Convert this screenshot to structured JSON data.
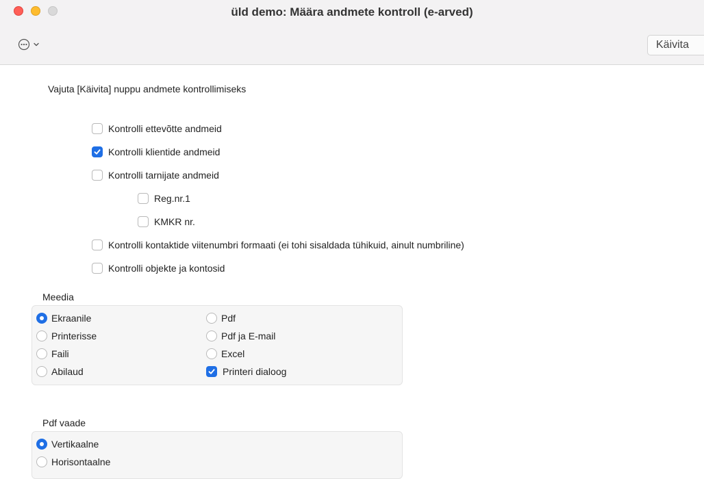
{
  "window": {
    "title": "üld demo: Määra andmete kontroll (e-arved)",
    "run_label": "Käivita",
    "more_icon": "ellipsis-circle-icon"
  },
  "instruction": "Vajuta [Käivita] nuppu andmete kontrollimiseks",
  "checks": [
    {
      "label": "Kontrolli ettevõtte andmeid",
      "checked": false
    },
    {
      "label": "Kontrolli klientide andmeid",
      "checked": true
    },
    {
      "label": "Kontrolli tarnijate andmeid",
      "checked": false
    },
    {
      "label": "Reg.nr.1",
      "checked": false
    },
    {
      "label": "KMKR nr.",
      "checked": false
    },
    {
      "label": "Kontrolli kontaktide viitenumbri formaati (ei tohi sisaldada tühikuid, ainult numbriline)",
      "checked": false
    },
    {
      "label": "Kontrolli objekte ja kontosid",
      "checked": false
    }
  ],
  "media": {
    "label": "Meedia",
    "left": [
      {
        "label": "Ekraanile",
        "selected": true
      },
      {
        "label": "Printerisse",
        "selected": false
      },
      {
        "label": "Faili",
        "selected": false
      },
      {
        "label": "Abilaud",
        "selected": false
      }
    ],
    "right": [
      {
        "label": "Pdf",
        "selected": false
      },
      {
        "label": "Pdf ja E-mail",
        "selected": false
      },
      {
        "label": "Excel",
        "selected": false
      }
    ],
    "printer_dialog": {
      "label": "Printeri dialoog",
      "checked": true
    }
  },
  "pdf_view": {
    "label": "Pdf vaade",
    "options": [
      {
        "label": "Vertikaalne",
        "selected": true
      },
      {
        "label": "Horisontaalne",
        "selected": false
      }
    ]
  },
  "colors": {
    "accent": "#1f6fe5"
  }
}
